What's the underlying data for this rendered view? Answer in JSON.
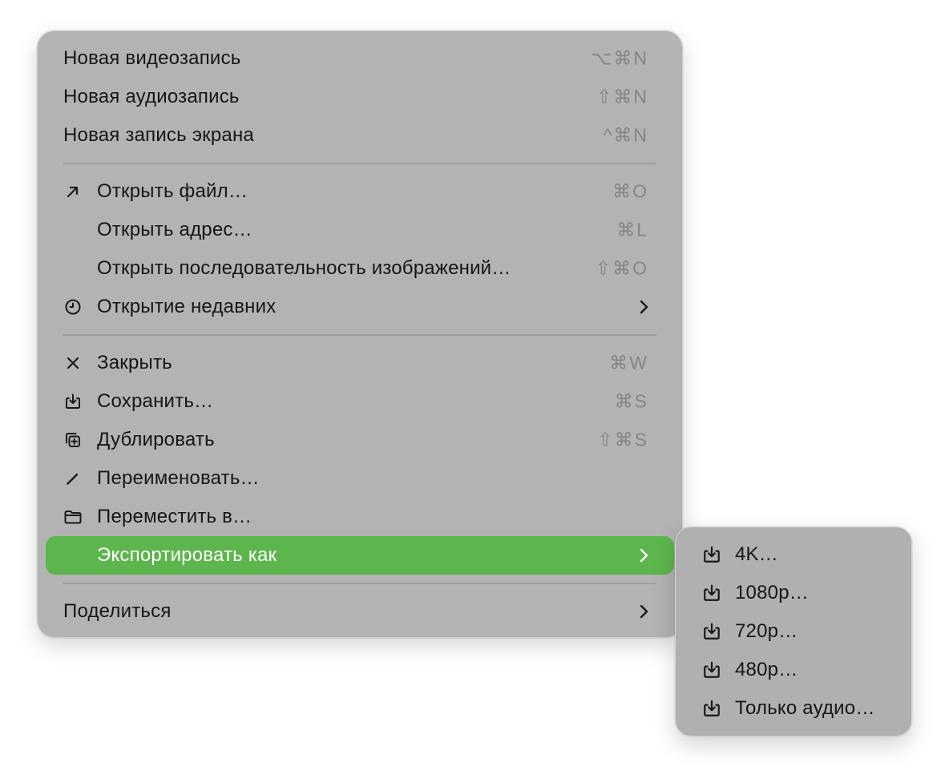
{
  "menu": {
    "new_video": {
      "label": "Новая видеозапись",
      "shortcut": "⌥⌘N"
    },
    "new_audio": {
      "label": "Новая аудиозапись",
      "shortcut": "⇧⌘N"
    },
    "new_screen": {
      "label": "Новая запись экрана",
      "shortcut": "^⌘N"
    },
    "open_file": {
      "label": "Открыть файл…",
      "shortcut": "⌘O",
      "icon": "arrow-up-right-icon"
    },
    "open_address": {
      "label": "Открыть адрес…",
      "shortcut": "⌘L"
    },
    "open_image_sequence": {
      "label": "Открыть последовательность изображений…",
      "shortcut": "⇧⌘O"
    },
    "open_recent": {
      "label": "Открытие недавних",
      "icon": "clock-icon"
    },
    "close": {
      "label": "Закрыть",
      "shortcut": "⌘W",
      "icon": "close-icon"
    },
    "save": {
      "label": "Сохранить…",
      "shortcut": "⌘S",
      "icon": "save-icon"
    },
    "duplicate": {
      "label": "Дублировать",
      "shortcut": "⇧⌘S",
      "icon": "duplicate-icon"
    },
    "rename": {
      "label": "Переименовать…",
      "icon": "pencil-icon"
    },
    "move_to": {
      "label": "Переместить в…",
      "icon": "folder-icon"
    },
    "export_as": {
      "label": "Экспортировать как"
    },
    "share": {
      "label": "Поделиться"
    }
  },
  "submenu": {
    "items": [
      {
        "label": "4K…"
      },
      {
        "label": "1080p…"
      },
      {
        "label": "720p…"
      },
      {
        "label": "480p…"
      },
      {
        "label": "Только аудио…"
      }
    ]
  },
  "colors": {
    "menu_bg": "#b3b3b3",
    "highlight": "#5db64d",
    "text": "#161616",
    "shortcut": "#858585"
  }
}
